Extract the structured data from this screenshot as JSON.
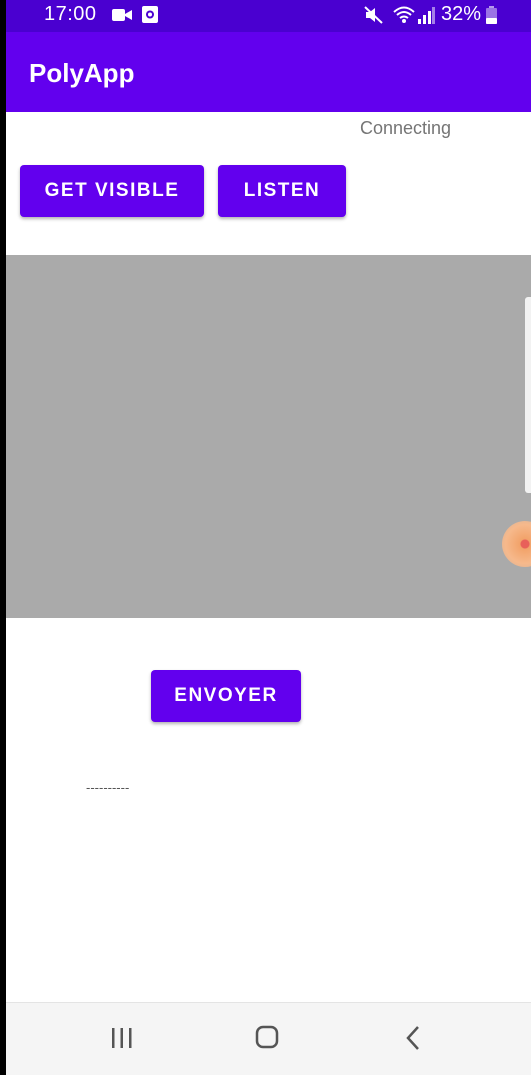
{
  "status_bar": {
    "time": "17:00",
    "battery_percent": "32%",
    "icons": [
      "video-icon",
      "screen-record-icon",
      "mute-icon",
      "wifi-icon",
      "signal-icon",
      "battery-icon"
    ]
  },
  "app_bar": {
    "title": "PolyApp"
  },
  "content": {
    "connection_status": "Connecting",
    "get_visible_label": "GET VISIBLE",
    "listen_label": "LISTEN",
    "envoyer_label": "ENVOYER",
    "message_text": "----------"
  },
  "nav_bar": {
    "icons": [
      "recents-icon",
      "home-icon",
      "back-icon"
    ]
  },
  "colors": {
    "status_bar": "#4a00d0",
    "primary": "#6200ee",
    "map_gray": "#aaaaaa",
    "background": "#ffffff",
    "nav_bar": "#f5f5f5"
  }
}
